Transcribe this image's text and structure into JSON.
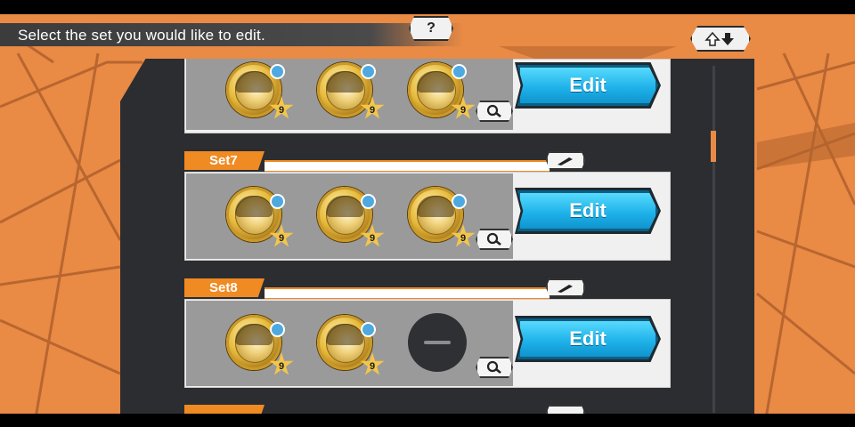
{
  "header": {
    "instruction": "Select the set you would like to edit.",
    "help_label": "?",
    "sort_label": "⇧🡇"
  },
  "sets": [
    {
      "name": "",
      "edit_label": "Edit",
      "slots": [
        {
          "filled": true,
          "level": "9"
        },
        {
          "filled": true,
          "level": "9"
        },
        {
          "filled": true,
          "level": "9"
        }
      ]
    },
    {
      "name": "Set7",
      "edit_label": "Edit",
      "slots": [
        {
          "filled": true,
          "level": "9"
        },
        {
          "filled": true,
          "level": "9"
        },
        {
          "filled": true,
          "level": "9"
        }
      ]
    },
    {
      "name": "Set8",
      "edit_label": "Edit",
      "slots": [
        {
          "filled": true,
          "level": "9"
        },
        {
          "filled": true,
          "level": "9"
        },
        {
          "filled": false,
          "level": ""
        }
      ]
    }
  ],
  "colors": {
    "accent_orange": "#f08a22",
    "edit_blue": "#1fb2ea",
    "background": "#e98a45"
  }
}
